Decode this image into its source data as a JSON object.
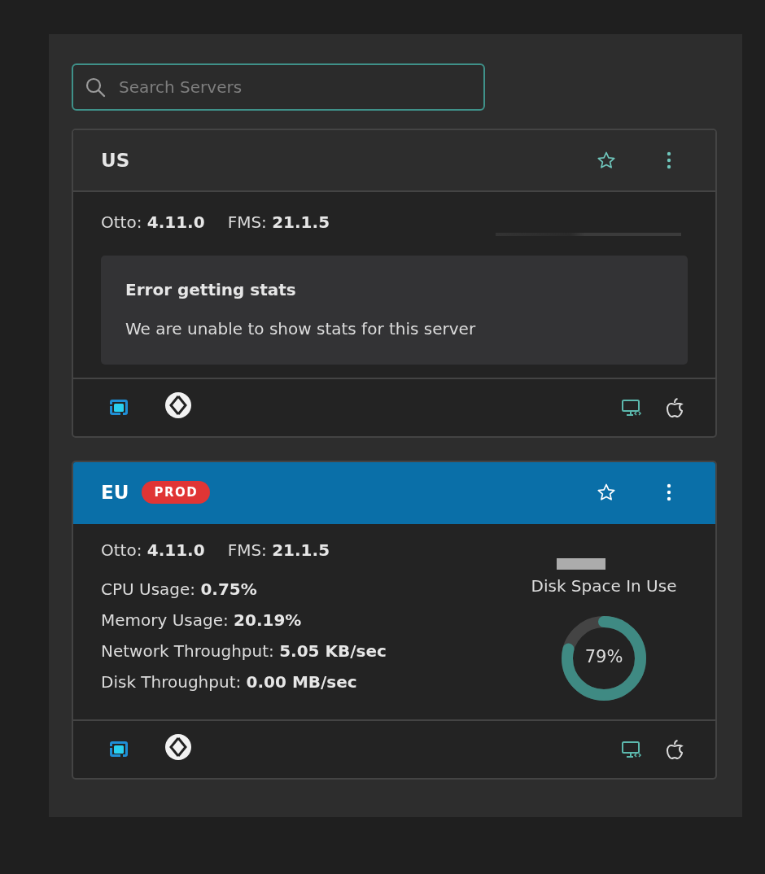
{
  "search": {
    "placeholder": "Search Servers",
    "focused": true
  },
  "servers": [
    {
      "name": "US",
      "selected": false,
      "favorite": false,
      "versions": [
        {
          "label": "Otto:",
          "value": "4.11.0"
        },
        {
          "label": "FMS:",
          "value": "21.1.5"
        }
      ],
      "kind": "error",
      "error": {
        "title": "Error getting stats",
        "message": "We are unable to show stats for this server"
      }
    },
    {
      "name": "EU",
      "badge": "PROD",
      "selected": true,
      "favorite": false,
      "versions": [
        {
          "label": "Otto:",
          "value": "4.11.0"
        },
        {
          "label": "FMS:",
          "value": "21.1.5"
        }
      ],
      "kind": "stats",
      "stats": [
        {
          "label": "CPU Usage:",
          "value": "0.75%"
        },
        {
          "label": "Memory Usage:",
          "value": "20.19%"
        },
        {
          "label": "Network Throughput:",
          "value": "5.05 KB/sec"
        },
        {
          "label": "Disk Throughput:",
          "value": "0.00 MB/sec"
        }
      ],
      "disk": {
        "label": "Disk Space In Use",
        "level": 0.79,
        "reading": "79%"
      }
    }
  ]
}
